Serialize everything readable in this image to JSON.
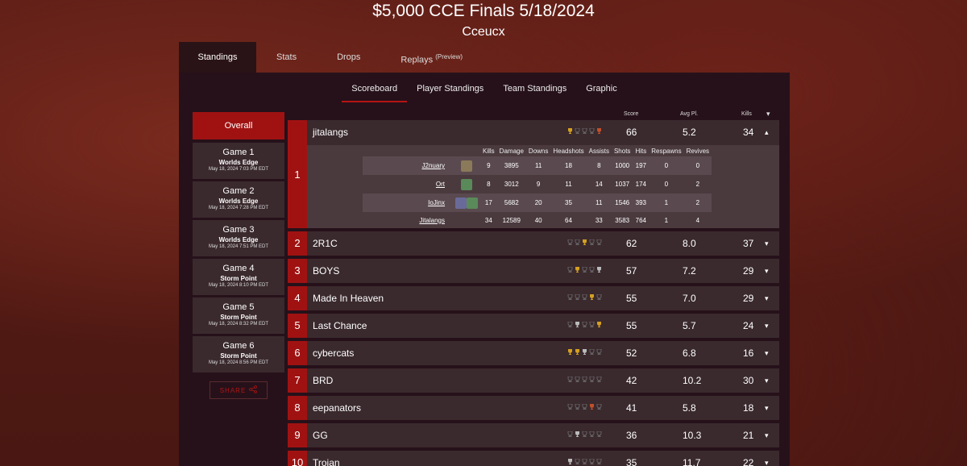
{
  "header": {
    "title": "$5,000 CCE Finals 5/18/2024",
    "subtitle": "Cceucx"
  },
  "main_tabs": [
    {
      "label": "Standings"
    },
    {
      "label": "Stats"
    },
    {
      "label": "Drops"
    },
    {
      "label": "Replays",
      "sup": "(Preview)"
    }
  ],
  "sub_tabs": [
    {
      "label": "Scoreboard"
    },
    {
      "label": "Player Standings"
    },
    {
      "label": "Team Standings"
    },
    {
      "label": "Graphic"
    }
  ],
  "sidebar": {
    "overall": "Overall",
    "games": [
      {
        "title": "Game 1",
        "map": "Worlds Edge",
        "date": "May 18, 2024 7:03 PM EDT"
      },
      {
        "title": "Game 2",
        "map": "Worlds Edge",
        "date": "May 18, 2024 7:28 PM EDT"
      },
      {
        "title": "Game 3",
        "map": "Worlds Edge",
        "date": "May 18, 2024 7:51 PM EDT"
      },
      {
        "title": "Game 4",
        "map": "Storm Point",
        "date": "May 18, 2024 8:10 PM EDT"
      },
      {
        "title": "Game 5",
        "map": "Storm Point",
        "date": "May 18, 2024 8:32 PM EDT"
      },
      {
        "title": "Game 6",
        "map": "Storm Point",
        "date": "May 18, 2024 8:56 PM EDT"
      }
    ],
    "share": "SHARE"
  },
  "columns": {
    "score": "Score",
    "avg": "Avg Pl.",
    "kills": "Kills"
  },
  "player_columns": [
    "Kills",
    "Damage",
    "Downs",
    "Headshots",
    "Assists",
    "Shots",
    "Hits",
    "Respawns",
    "Revives"
  ],
  "expanded_team": {
    "rank": "1",
    "team": "jitalangs",
    "score": "66",
    "avg": "5.2",
    "kills": "34",
    "players": [
      {
        "name": "J2nuary",
        "stats": [
          "9",
          "3895",
          "11",
          "18",
          "8",
          "1000",
          "197",
          "0",
          "0"
        ]
      },
      {
        "name": "Ort",
        "stats": [
          "8",
          "3012",
          "9",
          "11",
          "14",
          "1037",
          "174",
          "0",
          "2"
        ]
      },
      {
        "name": "IoJinx",
        "stats": [
          "17",
          "5682",
          "20",
          "35",
          "11",
          "1546",
          "393",
          "1",
          "2"
        ]
      }
    ],
    "total": {
      "name": "Jitalangs",
      "stats": [
        "34",
        "12589",
        "40",
        "64",
        "33",
        "3583",
        "764",
        "1",
        "4"
      ]
    }
  },
  "rows": [
    {
      "rank": "2",
      "team": "2R1C",
      "score": "62",
      "avg": "8.0",
      "kills": "37"
    },
    {
      "rank": "3",
      "team": "BOYS",
      "score": "57",
      "avg": "7.2",
      "kills": "29"
    },
    {
      "rank": "4",
      "team": "Made In Heaven",
      "score": "55",
      "avg": "7.0",
      "kills": "29"
    },
    {
      "rank": "5",
      "team": "Last Chance",
      "score": "55",
      "avg": "5.7",
      "kills": "24"
    },
    {
      "rank": "6",
      "team": "cybercats",
      "score": "52",
      "avg": "6.8",
      "kills": "16"
    },
    {
      "rank": "7",
      "team": "BRD",
      "score": "42",
      "avg": "10.2",
      "kills": "30"
    },
    {
      "rank": "8",
      "team": "eepanators",
      "score": "41",
      "avg": "5.8",
      "kills": "18"
    },
    {
      "rank": "9",
      "team": "GG",
      "score": "36",
      "avg": "10.3",
      "kills": "21"
    },
    {
      "rank": "10",
      "team": "Trojan",
      "score": "35",
      "avg": "11.7",
      "kills": "22"
    }
  ],
  "colors": {
    "accent": "#a01212",
    "panel": "#26111a",
    "row": "#3a2a2e"
  }
}
